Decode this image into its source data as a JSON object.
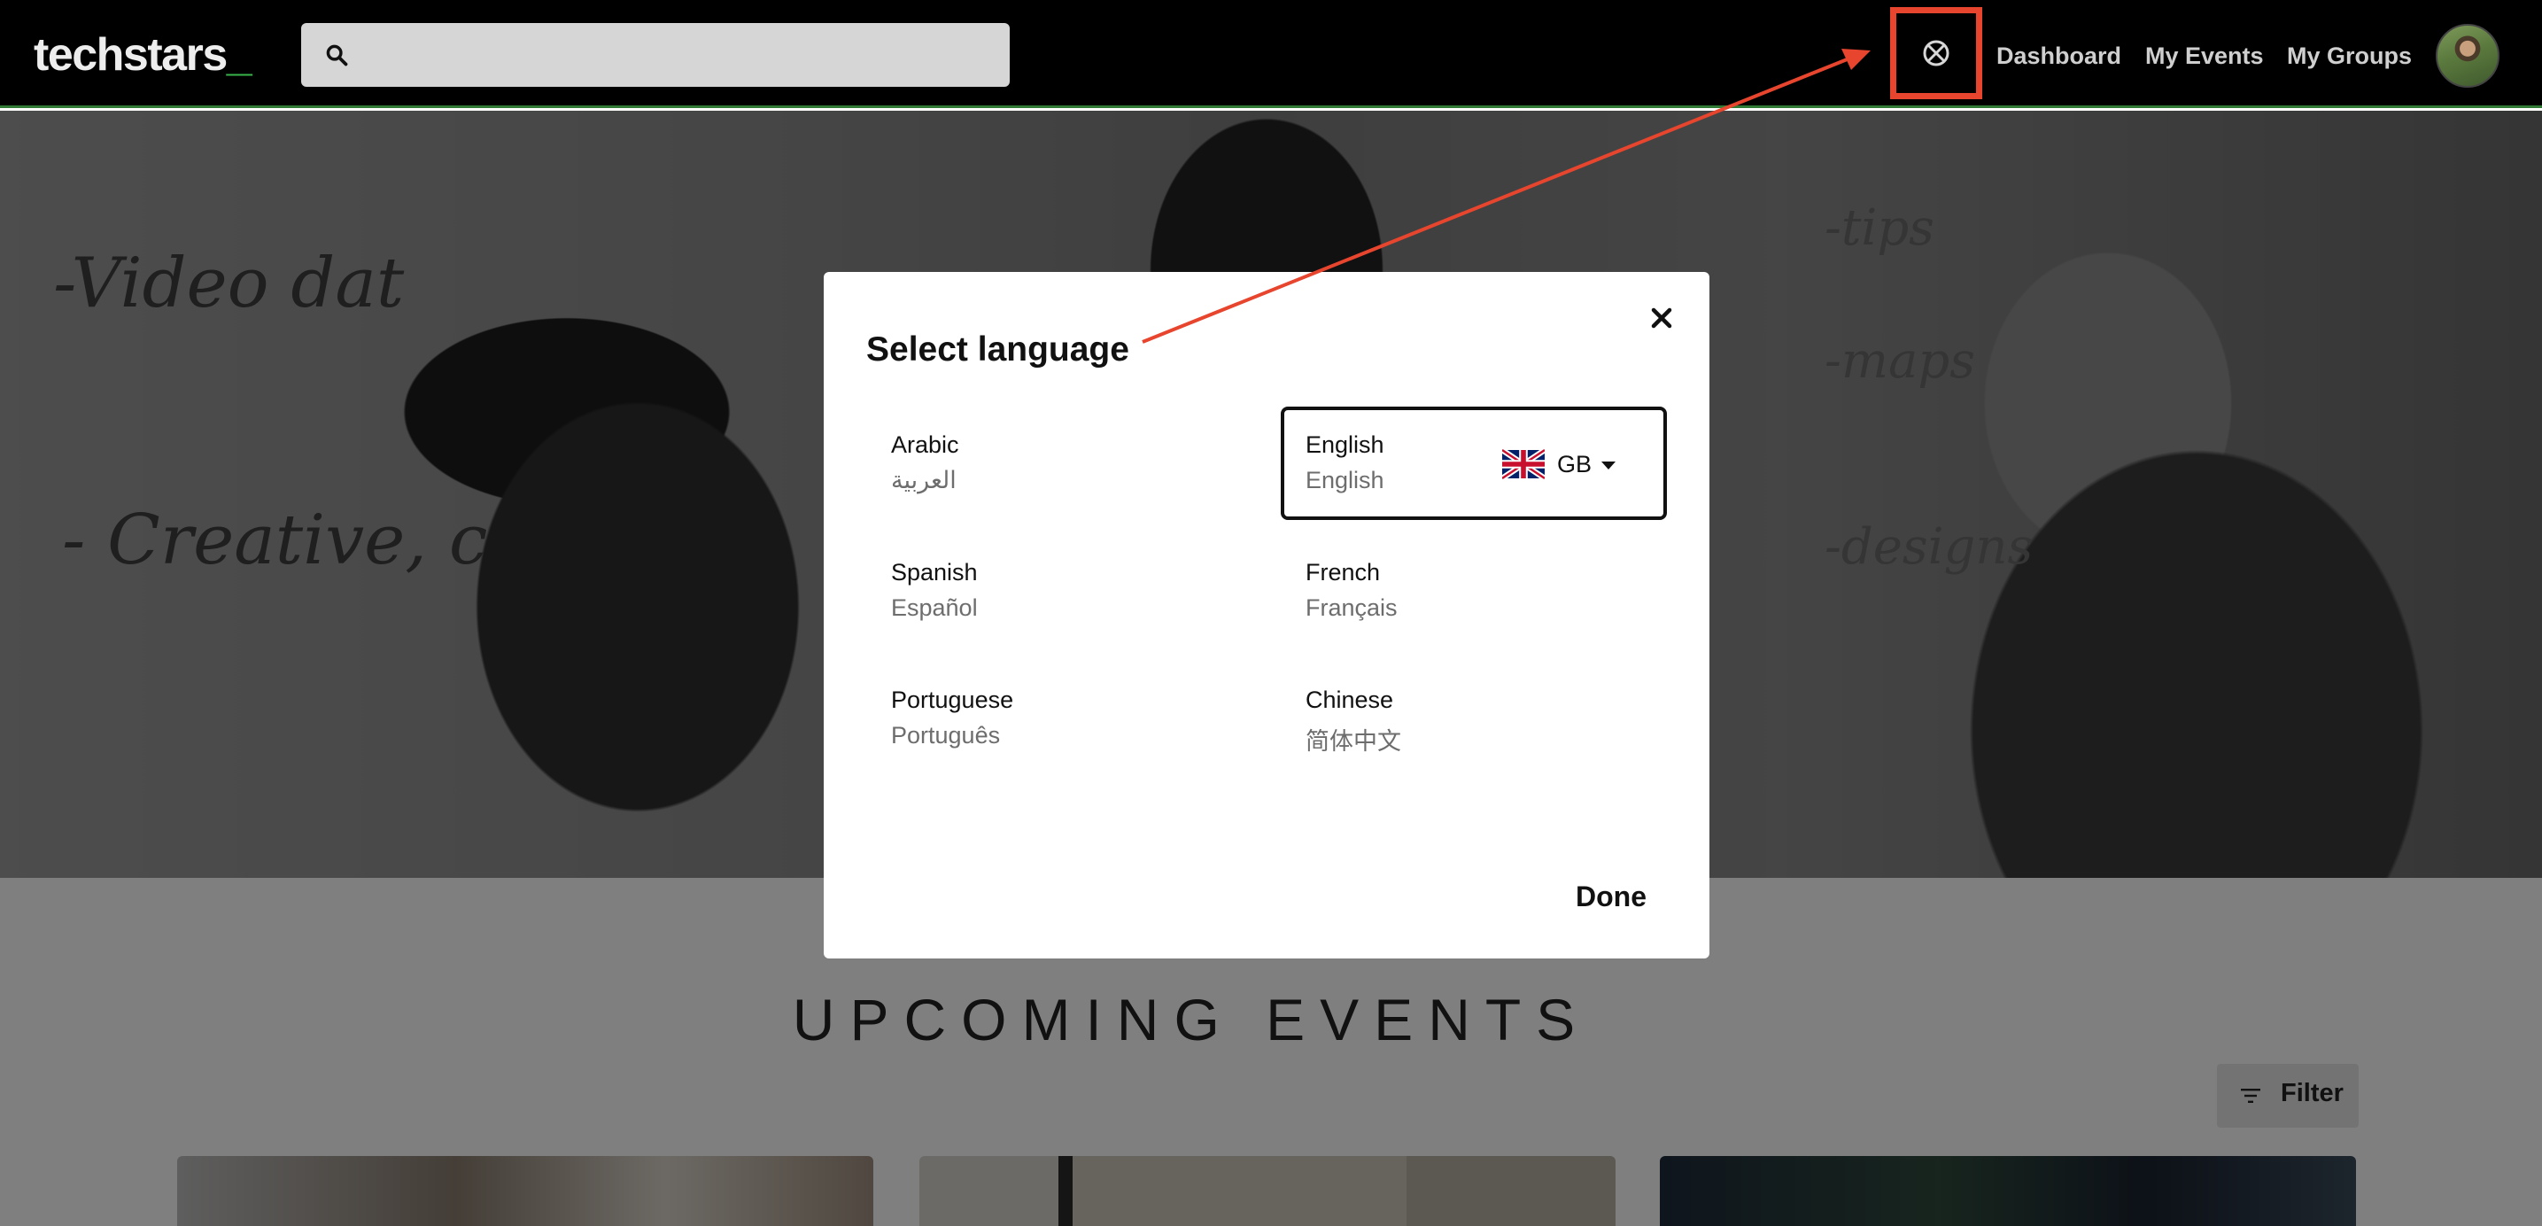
{
  "navbar": {
    "logo_text": "techstars",
    "logo_accent": "_",
    "search": {
      "placeholder": "",
      "value": ""
    },
    "language_button_icon": "language-globe-icon",
    "links": [
      "Dashboard",
      "My Events",
      "My Groups"
    ],
    "avatar_icon": "user-avatar"
  },
  "events": {
    "title": "UPCOMING EVENTS",
    "filter_label": "Filter",
    "filter_icon": "filter-lines-icon"
  },
  "modal": {
    "title": "Select language",
    "close_icon": "close-icon",
    "done_label": "Done",
    "languages": [
      {
        "name": "Arabic",
        "native": "العربية",
        "selected": false
      },
      {
        "name": "English",
        "native": "English",
        "selected": true,
        "region": "GB",
        "region_icon": "uk-flag-icon"
      },
      {
        "name": "Spanish",
        "native": "Español",
        "selected": false
      },
      {
        "name": "French",
        "native": "Français",
        "selected": false
      },
      {
        "name": "Portuguese",
        "native": "Português",
        "selected": false
      },
      {
        "name": "Chinese",
        "native": "简体中文",
        "selected": false
      }
    ]
  },
  "colors": {
    "navbar_bg": "#000000",
    "accent_green": "#39b54a",
    "annotation_red": "#e8452e"
  }
}
